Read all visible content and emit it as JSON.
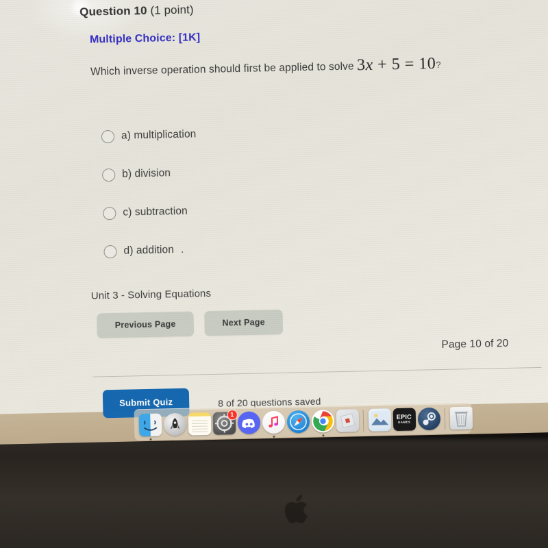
{
  "quiz": {
    "question_number_label": "Question 10",
    "points_label": "(1 point)",
    "type_label": "Multiple Choice: [1K]",
    "prompt_prefix": "Which inverse operation should first be applied to solve",
    "equation": "3x + 5 = 10",
    "equation_coefficient": "3",
    "equation_variable": "x",
    "equation_plus": "+",
    "equation_addend": "5",
    "equation_equals": "=",
    "equation_result": "10",
    "prompt_suffix": "?",
    "options": [
      {
        "id": "a",
        "label": "a) multiplication",
        "selected": false
      },
      {
        "id": "b",
        "label": "b) division",
        "selected": false
      },
      {
        "id": "c",
        "label": "c) subtraction",
        "selected": false
      },
      {
        "id": "d",
        "label": "d) addition",
        "selected": false
      }
    ],
    "option_d_trailing_mark": ".",
    "unit_label": "Unit 3 - Solving Equations",
    "previous_page_label": "Previous Page",
    "next_page_label": "Next Page",
    "page_indicator": "Page 10 of 20",
    "submit_label": "Submit Quiz",
    "saved_status": "8 of 20 questions saved",
    "type_color": "#3530c4",
    "submit_color": "#1668b0",
    "nav_button_color": "#c8ccc2"
  },
  "dock": {
    "items": [
      {
        "name": "finder",
        "label": "Finder",
        "running": true,
        "badge": ""
      },
      {
        "name": "launchpad",
        "label": "Launchpad",
        "running": false,
        "badge": ""
      },
      {
        "name": "notes",
        "label": "Notes",
        "running": false,
        "badge": ""
      },
      {
        "name": "system-preferences",
        "label": "System Preferences",
        "running": false,
        "badge": "1"
      },
      {
        "name": "discord",
        "label": "Discord",
        "running": false,
        "badge": ""
      },
      {
        "name": "music",
        "label": "Music",
        "running": true,
        "badge": ""
      },
      {
        "name": "safari",
        "label": "Safari",
        "running": false,
        "badge": ""
      },
      {
        "name": "chrome",
        "label": "Google Chrome",
        "running": true,
        "badge": ""
      },
      {
        "name": "roblox",
        "label": "Roblox",
        "running": false,
        "badge": ""
      },
      {
        "name": "preview",
        "label": "Preview",
        "running": false,
        "badge": ""
      },
      {
        "name": "epic-games",
        "label": "Epic Games",
        "running": false,
        "badge": "",
        "text_top": "EPIC",
        "text_bottom": "GAMES"
      },
      {
        "name": "steam",
        "label": "Steam",
        "running": false,
        "badge": ""
      },
      {
        "name": "trash",
        "label": "Trash",
        "running": false,
        "badge": ""
      }
    ]
  },
  "device": {
    "brand_logo": "apple-logo"
  }
}
